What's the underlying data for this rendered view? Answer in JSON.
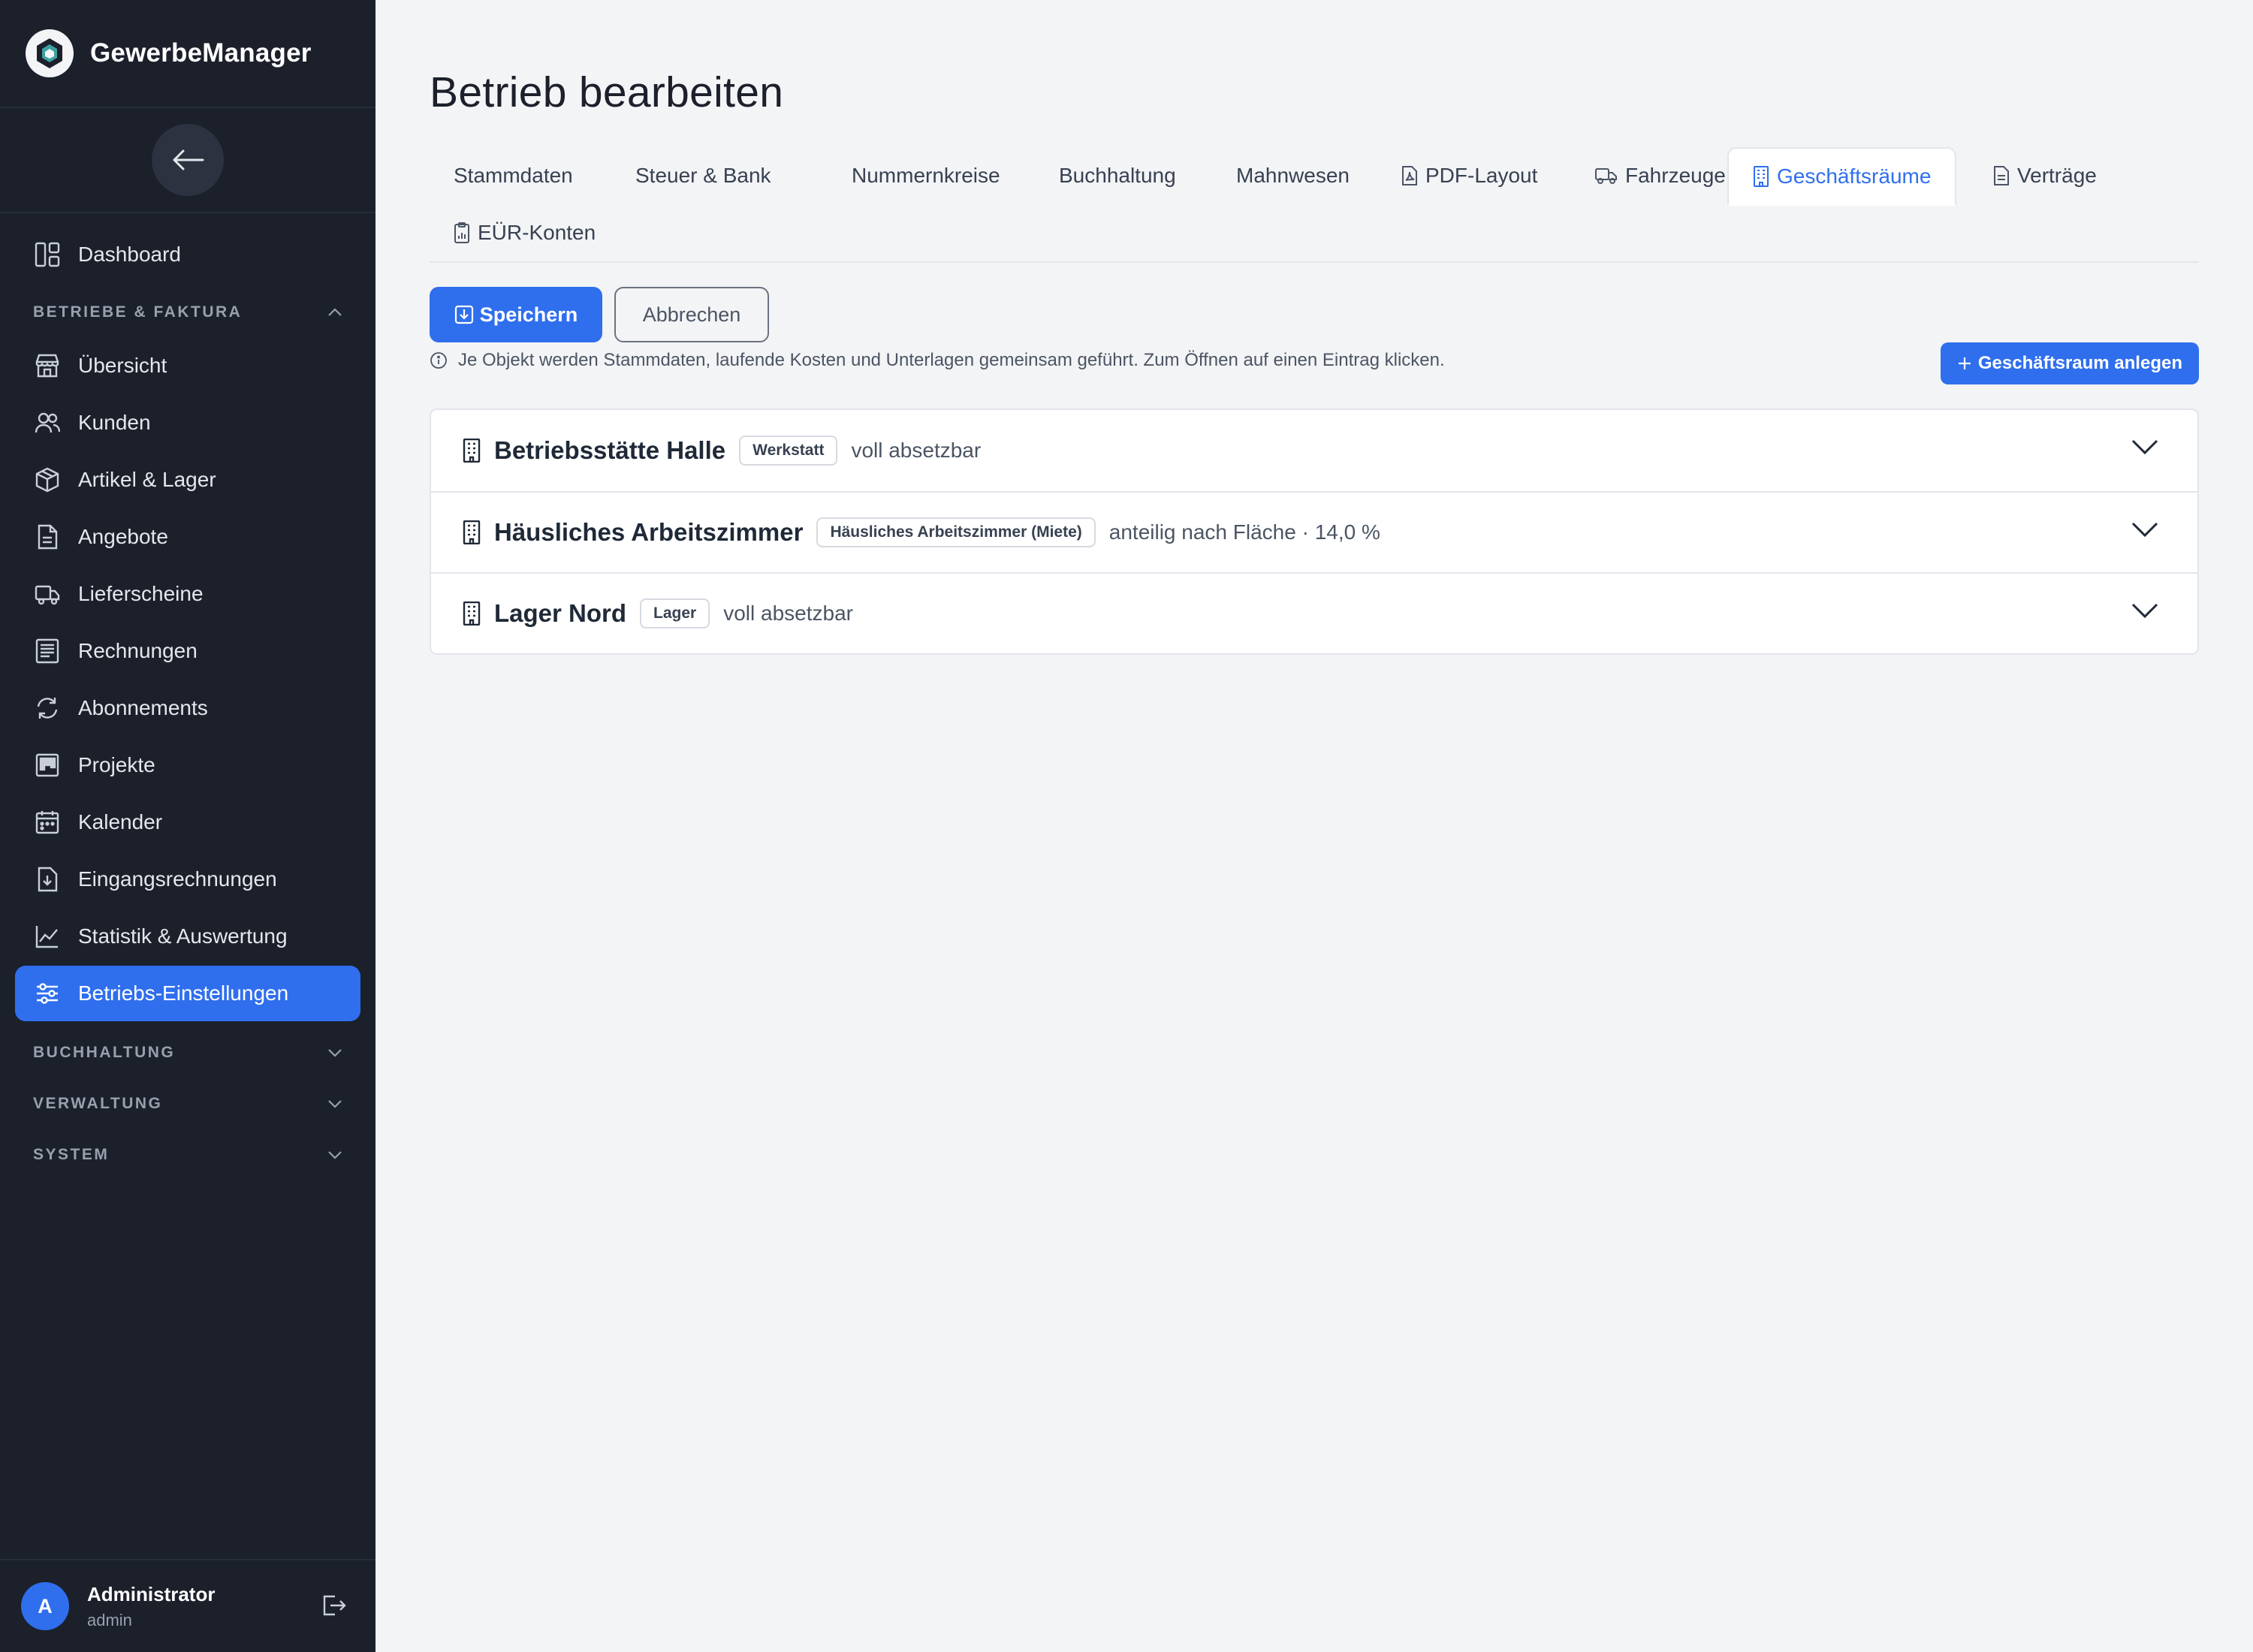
{
  "app": {
    "name": "GewerbeManager"
  },
  "sidebar": {
    "dashboard_label": "Dashboard",
    "sections": [
      {
        "label": "BETRIEBE & FAKTURA",
        "expanded": true
      },
      {
        "label": "BUCHHALTUNG",
        "expanded": false
      },
      {
        "label": "VERWALTUNG",
        "expanded": false
      },
      {
        "label": "SYSTEM",
        "expanded": false
      }
    ],
    "items": [
      {
        "label": "Übersicht",
        "icon": "store-icon"
      },
      {
        "label": "Kunden",
        "icon": "users-icon"
      },
      {
        "label": "Artikel & Lager",
        "icon": "box-icon"
      },
      {
        "label": "Angebote",
        "icon": "document-icon"
      },
      {
        "label": "Lieferscheine",
        "icon": "truck-icon"
      },
      {
        "label": "Rechnungen",
        "icon": "receipt-icon"
      },
      {
        "label": "Abonnements",
        "icon": "refresh-icon"
      },
      {
        "label": "Projekte",
        "icon": "kanban-icon"
      },
      {
        "label": "Kalender",
        "icon": "calendar-icon"
      },
      {
        "label": "Eingangsrechnungen",
        "icon": "inbox-document-icon"
      },
      {
        "label": "Statistik & Auswertung",
        "icon": "chart-line-icon"
      },
      {
        "label": "Betriebs-Einstellungen",
        "icon": "sliders-icon",
        "active": true
      }
    ],
    "user": {
      "initial": "A",
      "name": "Administrator",
      "role": "admin"
    }
  },
  "page": {
    "title": "Betrieb bearbeiten",
    "tabs": [
      {
        "label": "Stammdaten"
      },
      {
        "label": "Steuer & Bank"
      },
      {
        "label": "Nummernkreise"
      },
      {
        "label": "Buchhaltung"
      },
      {
        "label": "Mahnwesen"
      },
      {
        "label": "PDF-Layout",
        "icon": "pdf-icon"
      },
      {
        "label": "Fahrzeuge",
        "icon": "truck-icon"
      },
      {
        "label": "Geschäftsräume",
        "icon": "building-icon",
        "active": true
      },
      {
        "label": "Verträge",
        "icon": "document-icon"
      },
      {
        "label": "EÜR-Konten",
        "icon": "clipboard-chart-icon"
      }
    ],
    "save_label": "Speichern",
    "cancel_label": "Abbrechen",
    "info_text": "Je Objekt werden Stammdaten, laufende Kosten und Unterlagen gemeinsam geführt. Zum Öffnen auf einen Eintrag klicken.",
    "add_label": "Geschäftsraum anlegen",
    "premises": [
      {
        "name": "Betriebsstätte Halle",
        "badge": "Werkstatt",
        "meta": "voll absetzbar"
      },
      {
        "name": "Häusliches Arbeitszimmer",
        "badge": "Häusliches Arbeitszimmer (Miete)",
        "meta": "anteilig nach Fläche · 14,0 %"
      },
      {
        "name": "Lager Nord",
        "badge": "Lager",
        "meta": "voll absetzbar"
      }
    ]
  },
  "colors": {
    "accent": "#2f6fed",
    "sidebar_bg": "#1b202b",
    "page_bg": "#f3f4f6"
  }
}
